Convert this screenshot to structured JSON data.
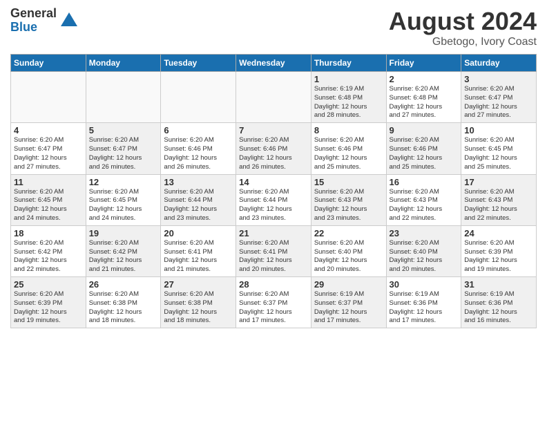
{
  "header": {
    "logo_general": "General",
    "logo_blue": "Blue",
    "month_year": "August 2024",
    "location": "Gbetogo, Ivory Coast"
  },
  "days_of_week": [
    "Sunday",
    "Monday",
    "Tuesday",
    "Wednesday",
    "Thursday",
    "Friday",
    "Saturday"
  ],
  "weeks": [
    [
      {
        "day": "",
        "info": ""
      },
      {
        "day": "",
        "info": ""
      },
      {
        "day": "",
        "info": ""
      },
      {
        "day": "",
        "info": ""
      },
      {
        "day": "1",
        "info": "Sunrise: 6:19 AM\nSunset: 6:48 PM\nDaylight: 12 hours\nand 28 minutes."
      },
      {
        "day": "2",
        "info": "Sunrise: 6:20 AM\nSunset: 6:48 PM\nDaylight: 12 hours\nand 27 minutes."
      },
      {
        "day": "3",
        "info": "Sunrise: 6:20 AM\nSunset: 6:47 PM\nDaylight: 12 hours\nand 27 minutes."
      }
    ],
    [
      {
        "day": "4",
        "info": "Sunrise: 6:20 AM\nSunset: 6:47 PM\nDaylight: 12 hours\nand 27 minutes."
      },
      {
        "day": "5",
        "info": "Sunrise: 6:20 AM\nSunset: 6:47 PM\nDaylight: 12 hours\nand 26 minutes."
      },
      {
        "day": "6",
        "info": "Sunrise: 6:20 AM\nSunset: 6:46 PM\nDaylight: 12 hours\nand 26 minutes."
      },
      {
        "day": "7",
        "info": "Sunrise: 6:20 AM\nSunset: 6:46 PM\nDaylight: 12 hours\nand 26 minutes."
      },
      {
        "day": "8",
        "info": "Sunrise: 6:20 AM\nSunset: 6:46 PM\nDaylight: 12 hours\nand 25 minutes."
      },
      {
        "day": "9",
        "info": "Sunrise: 6:20 AM\nSunset: 6:46 PM\nDaylight: 12 hours\nand 25 minutes."
      },
      {
        "day": "10",
        "info": "Sunrise: 6:20 AM\nSunset: 6:45 PM\nDaylight: 12 hours\nand 25 minutes."
      }
    ],
    [
      {
        "day": "11",
        "info": "Sunrise: 6:20 AM\nSunset: 6:45 PM\nDaylight: 12 hours\nand 24 minutes."
      },
      {
        "day": "12",
        "info": "Sunrise: 6:20 AM\nSunset: 6:45 PM\nDaylight: 12 hours\nand 24 minutes."
      },
      {
        "day": "13",
        "info": "Sunrise: 6:20 AM\nSunset: 6:44 PM\nDaylight: 12 hours\nand 23 minutes."
      },
      {
        "day": "14",
        "info": "Sunrise: 6:20 AM\nSunset: 6:44 PM\nDaylight: 12 hours\nand 23 minutes."
      },
      {
        "day": "15",
        "info": "Sunrise: 6:20 AM\nSunset: 6:43 PM\nDaylight: 12 hours\nand 23 minutes."
      },
      {
        "day": "16",
        "info": "Sunrise: 6:20 AM\nSunset: 6:43 PM\nDaylight: 12 hours\nand 22 minutes."
      },
      {
        "day": "17",
        "info": "Sunrise: 6:20 AM\nSunset: 6:43 PM\nDaylight: 12 hours\nand 22 minutes."
      }
    ],
    [
      {
        "day": "18",
        "info": "Sunrise: 6:20 AM\nSunset: 6:42 PM\nDaylight: 12 hours\nand 22 minutes."
      },
      {
        "day": "19",
        "info": "Sunrise: 6:20 AM\nSunset: 6:42 PM\nDaylight: 12 hours\nand 21 minutes."
      },
      {
        "day": "20",
        "info": "Sunrise: 6:20 AM\nSunset: 6:41 PM\nDaylight: 12 hours\nand 21 minutes."
      },
      {
        "day": "21",
        "info": "Sunrise: 6:20 AM\nSunset: 6:41 PM\nDaylight: 12 hours\nand 20 minutes."
      },
      {
        "day": "22",
        "info": "Sunrise: 6:20 AM\nSunset: 6:40 PM\nDaylight: 12 hours\nand 20 minutes."
      },
      {
        "day": "23",
        "info": "Sunrise: 6:20 AM\nSunset: 6:40 PM\nDaylight: 12 hours\nand 20 minutes."
      },
      {
        "day": "24",
        "info": "Sunrise: 6:20 AM\nSunset: 6:39 PM\nDaylight: 12 hours\nand 19 minutes."
      }
    ],
    [
      {
        "day": "25",
        "info": "Sunrise: 6:20 AM\nSunset: 6:39 PM\nDaylight: 12 hours\nand 19 minutes."
      },
      {
        "day": "26",
        "info": "Sunrise: 6:20 AM\nSunset: 6:38 PM\nDaylight: 12 hours\nand 18 minutes."
      },
      {
        "day": "27",
        "info": "Sunrise: 6:20 AM\nSunset: 6:38 PM\nDaylight: 12 hours\nand 18 minutes."
      },
      {
        "day": "28",
        "info": "Sunrise: 6:20 AM\nSunset: 6:37 PM\nDaylight: 12 hours\nand 17 minutes."
      },
      {
        "day": "29",
        "info": "Sunrise: 6:19 AM\nSunset: 6:37 PM\nDaylight: 12 hours\nand 17 minutes."
      },
      {
        "day": "30",
        "info": "Sunrise: 6:19 AM\nSunset: 6:36 PM\nDaylight: 12 hours\nand 17 minutes."
      },
      {
        "day": "31",
        "info": "Sunrise: 6:19 AM\nSunset: 6:36 PM\nDaylight: 12 hours\nand 16 minutes."
      }
    ]
  ]
}
